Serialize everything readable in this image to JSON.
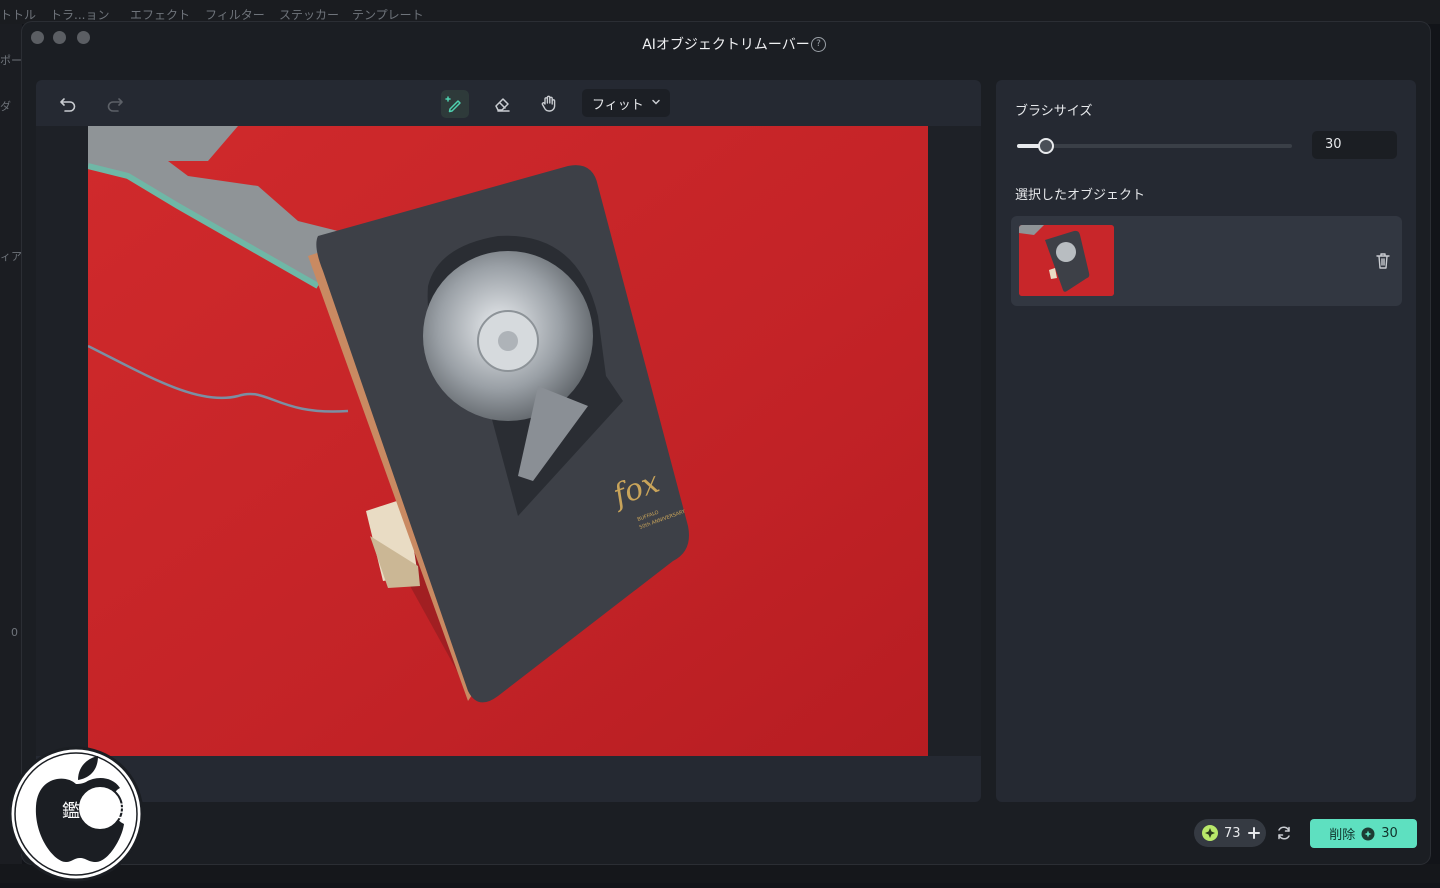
{
  "background_app": {
    "menu": [
      "トトル",
      "トラ...ョン",
      "エフェクト",
      "フィルター",
      "ステッカー",
      "テンプレート"
    ],
    "side_fragments": [
      "ポー",
      "ダ",
      "ィア",
      "0"
    ]
  },
  "dialog": {
    "title": "AIオブジェクトリムーバー"
  },
  "toolbar": {
    "undo": "undo-icon",
    "redo": "redo-icon",
    "brush": "brush-icon",
    "eraser": "eraser-icon",
    "hand": "hand-icon",
    "fit_label": "フィット"
  },
  "photo": {
    "sticker_brand": "fox",
    "sticker_line1": "BUFFALO",
    "sticker_line2": "50th ANNIVERSARY"
  },
  "side": {
    "brush_size_label": "ブラシサイズ",
    "brush_size_value": "30",
    "brush_size_fraction": 0.1,
    "selected_objects_label": "選択したオブジェクト"
  },
  "footer": {
    "credits": "73",
    "remove_label": "削除",
    "remove_cost": "30"
  },
  "watermark": {
    "text": "鑑 済 定"
  },
  "colors": {
    "accent": "#5ee0c0",
    "credit_icon": "#b8e86a",
    "brush_active": "#4fd1b0",
    "photo_red": "#c8262a"
  }
}
